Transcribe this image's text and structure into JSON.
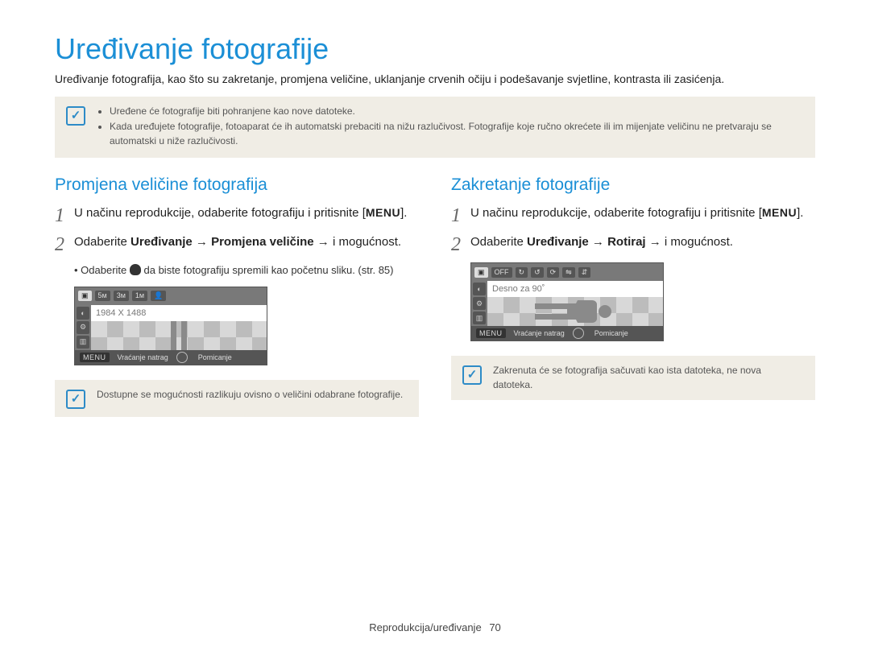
{
  "title": "Uređivanje fotografije",
  "intro": "Uređivanje fotografija, kao što su zakretanje, promjena veličine, uklanjanje crvenih očiju i podešavanje svjetline, kontrasta ili zasićenja.",
  "top_note": {
    "items": [
      "Uređene će fotografije biti pohranjene kao nove datoteke.",
      "Kada uređujete fotografije, fotoaparat će ih automatski prebaciti na nižu razlučivost. Fotografije koje ručno okrećete ili im mijenjate veličinu ne pretvaraju se automatski u niže razlučivosti."
    ]
  },
  "left": {
    "heading": "Promjena veličine fotografija",
    "step1_a": "U načinu reprodukcije, odaberite fotografiju i pritisnite ",
    "menu_open": "[",
    "menu_label": "MENU",
    "menu_close": "].",
    "step2_a": "Odaberite ",
    "step2_b": "Uređivanje → Promjena veličine →",
    "step2_c": " i mogućnost.",
    "bullet_a": "Odaberite ",
    "bullet_b": " da biste fotografiju spremili kao početnu sliku. (str. 85)",
    "lcd": {
      "chips": [
        "5м",
        "3м",
        "1м"
      ],
      "readout": "1984 X 1488",
      "footer_menu": "MENU",
      "footer_back": "Vraćanje natrag",
      "footer_move": "Pomicanje"
    },
    "note": "Dostupne se mogućnosti razlikuju ovisno o veličini odabrane fotografije."
  },
  "right": {
    "heading": "Zakretanje fotografije",
    "step1_a": "U načinu reprodukcije, odaberite fotografiju i pritisnite ",
    "step2_a": "Odaberite ",
    "step2_b": "Uređivanje → Rotiraj",
    "step2_c": " → i mogućnost.",
    "lcd": {
      "readout": "Desno za 90˚",
      "footer_menu": "MENU",
      "footer_back": "Vraćanje natrag",
      "footer_move": "Pomicanje"
    },
    "note": "Zakrenuta će se fotografija sačuvati kao ista datoteka, ne nova datoteka."
  },
  "footer": {
    "section": "Reprodukcija/uređivanje",
    "page": "70"
  }
}
